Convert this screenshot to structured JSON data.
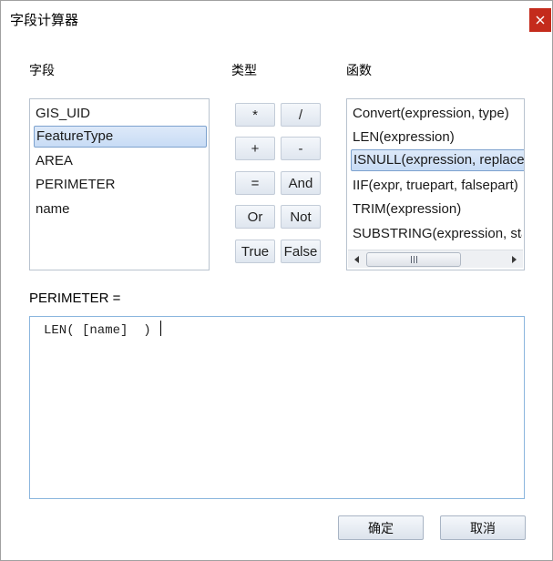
{
  "window": {
    "title": "字段计算器",
    "close_icon": "close-icon",
    "close_color": "#c42b1c"
  },
  "fields": {
    "label": "字段",
    "items": [
      "GIS_UID",
      "FeatureType",
      "AREA",
      "PERIMETER",
      "name"
    ],
    "selected": "FeatureType"
  },
  "types": {
    "label": "类型",
    "buttons": [
      "*",
      "/",
      "+",
      "-",
      "=",
      "And",
      "Or",
      "Not",
      "True",
      "False"
    ]
  },
  "functions": {
    "label": "函数",
    "items": [
      "Convert(expression, type)",
      "LEN(expression)",
      "ISNULL(expression, replacement)",
      "IIF(expr, truepart, falsepart)",
      "TRIM(expression)",
      "SUBSTRING(expression, start, length)"
    ],
    "selected": "ISNULL(expression, replacement)",
    "scrollbar": {
      "left_icon": "arrow-left-icon",
      "right_icon": "arrow-right-icon",
      "thumb_grip_icon": "grip-icon"
    }
  },
  "expression": {
    "label": "PERIMETER =",
    "value": "LEN( [name]  ) "
  },
  "buttons": {
    "ok": "确定",
    "cancel": "取消"
  }
}
